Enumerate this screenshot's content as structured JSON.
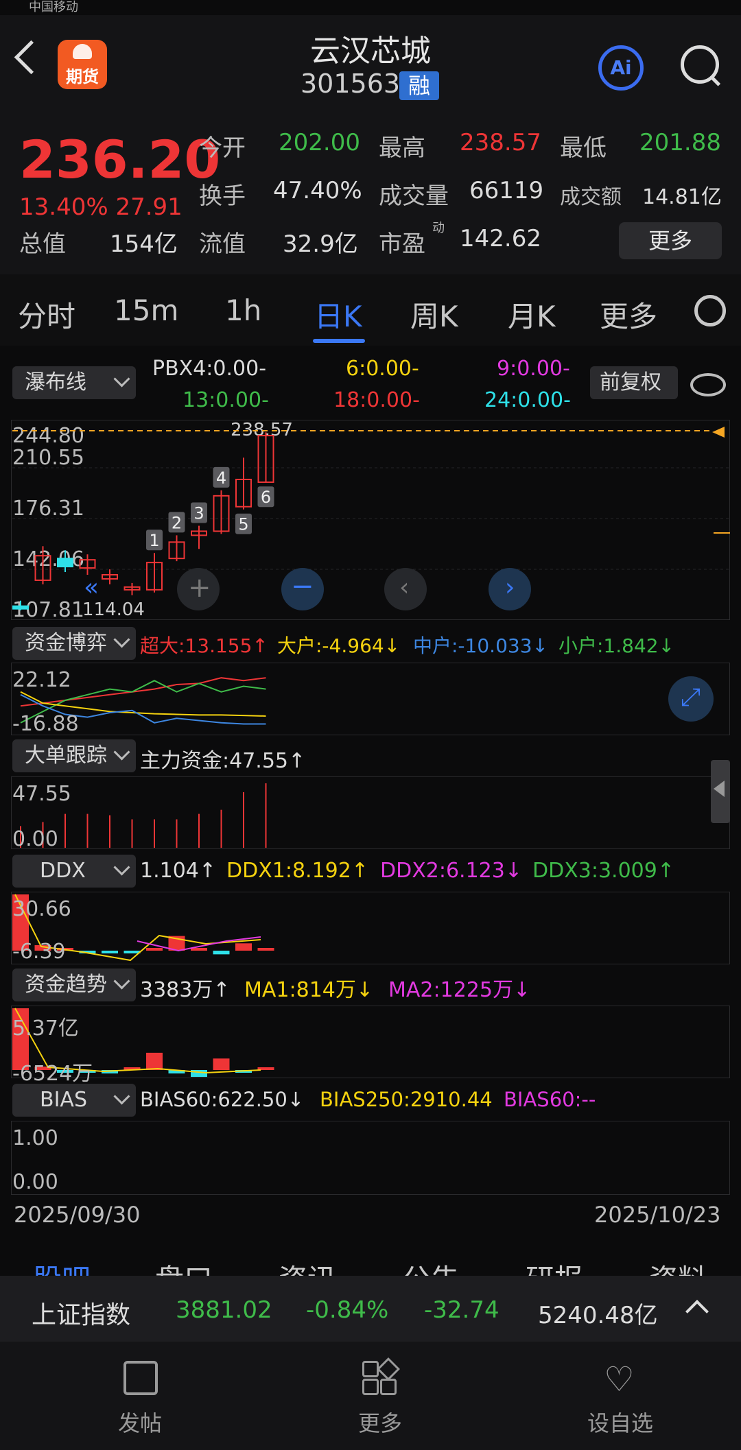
{
  "status": {
    "carrier": "中国移动"
  },
  "header": {
    "title": "云汉芯城",
    "code": "301563",
    "margin_badge": "融",
    "futures_label": "期货",
    "ai_label": "Ai"
  },
  "quote": {
    "price": "236.20",
    "change_pct": "13.40%",
    "change": "27.91",
    "open_label": "今开",
    "open": "202.00",
    "high_label": "最高",
    "high": "238.57",
    "low_label": "最低",
    "low": "201.88",
    "turnover_label": "换手",
    "turnover": "47.40%",
    "volume_label": "成交量",
    "volume": "66119",
    "amount_label": "成交额",
    "amount": "14.81亿",
    "mcap_label": "总值",
    "mcap": "154亿",
    "float_label": "流值",
    "float": "32.9亿",
    "pe_label": "市盈",
    "pe_sup": "动",
    "pe": "142.62",
    "more": "更多"
  },
  "tabs": [
    {
      "label": "分时"
    },
    {
      "label": "15m"
    },
    {
      "label": "1h"
    },
    {
      "label": "日K"
    },
    {
      "label": "周K"
    },
    {
      "label": "月K"
    },
    {
      "label": "更多"
    }
  ],
  "indicator_bar": {
    "select": "瀑布线",
    "pbx4": "PBX4:0.00-",
    "p6": "6:0.00-",
    "p9": "9:0.00-",
    "p13": "13:0.00-",
    "p18": "18:0.00-",
    "p24": "24:0.00-",
    "adjust": "前复权"
  },
  "kline": {
    "y_top": "244.80",
    "y2": "210.55",
    "y3": "176.31",
    "y4": "142.06",
    "y_bottom": "107.81",
    "max_label": "238.57",
    "min_label": "114.04",
    "badges": [
      "1",
      "2",
      "3",
      "4",
      "5",
      "6"
    ]
  },
  "capital_game": {
    "select": "资金博弈",
    "super": "超大:13.155↑",
    "large": "大户:-4.964↓",
    "mid": "中户:-10.033↓",
    "small": "小户:1.842↓",
    "y_top": "22.12",
    "y_bottom": "-16.88"
  },
  "big_order": {
    "select": "大单跟踪",
    "main": "主力资金:47.55↑",
    "y_top": "47.55",
    "y_bottom": "0.00"
  },
  "ddx": {
    "select": "DDX",
    "val": "1.104↑",
    "ddx1": "DDX1:8.192↑",
    "ddx2": "DDX2:6.123↓",
    "ddx3": "DDX3:3.009↑",
    "y_top": "30.66",
    "y_bottom": "-6.39"
  },
  "fund_trend": {
    "select": "资金趋势",
    "val": "3383万↑",
    "ma1": "MA1:814万↓",
    "ma2": "MA2:1225万↓",
    "y_top": "5.37亿",
    "y_bottom": "-6524万"
  },
  "bias": {
    "select": "BIAS",
    "b60": "BIAS60:622.50↓",
    "b250": "BIAS250:2910.44",
    "b60b": "BIAS60:--",
    "y_top": "1.00",
    "y_bottom": "0.00"
  },
  "dates": {
    "start": "2025/09/30",
    "end": "2025/10/23"
  },
  "subtabs": [
    "股吧",
    "盘口",
    "资讯",
    "公告",
    "研报",
    "资料"
  ],
  "ticker": {
    "name": "上证指数",
    "value": "3881.02",
    "pct": "-0.84%",
    "chg": "-32.74",
    "amount": "5240.48亿"
  },
  "nav": {
    "post": "发帖",
    "more": "更多",
    "watch": "设自选"
  },
  "colors": {
    "up": "#ee3536",
    "down": "#3fbb4a",
    "accent": "#3b78f5",
    "cyan": "#2ee0e8",
    "yellow": "#f5d20f",
    "magenta": "#e23ae0",
    "blue": "#3d86e0"
  },
  "chart_data": {
    "type": "candlestick",
    "candles": [
      {
        "o": 111,
        "h": 115,
        "l": 108,
        "c": 109
      },
      {
        "o": 130,
        "h": 155,
        "l": 127,
        "c": 148
      },
      {
        "o": 146,
        "h": 152,
        "l": 136,
        "c": 140
      },
      {
        "o": 139,
        "h": 149,
        "l": 134,
        "c": 145
      },
      {
        "o": 131,
        "h": 138,
        "l": 127,
        "c": 134
      },
      {
        "o": 123,
        "h": 128,
        "l": 119,
        "c": 125
      },
      {
        "o": 123,
        "h": 150,
        "l": 121,
        "c": 143
      },
      {
        "o": 146,
        "h": 163,
        "l": 144,
        "c": 158
      },
      {
        "o": 163,
        "h": 170,
        "l": 153,
        "c": 166
      },
      {
        "o": 166,
        "h": 196,
        "l": 164,
        "c": 192
      },
      {
        "o": 184,
        "h": 220,
        "l": 182,
        "c": 204
      },
      {
        "o": 202,
        "h": 238.57,
        "l": 201.88,
        "c": 236.2
      }
    ],
    "ylim": [
      107.81,
      244.8
    ],
    "big_order_values": [
      16,
      19,
      25,
      25,
      24,
      21,
      21,
      21,
      25,
      28,
      41,
      47.55
    ],
    "ddx_values": [
      30.66,
      3,
      0,
      -1,
      -1,
      -1,
      0,
      8,
      0,
      -2,
      4,
      1.1
    ],
    "fund_trend_values": [
      5.37,
      0.3,
      -0.1,
      -0.1,
      -0.3,
      0.1,
      1.5,
      -0.3,
      -0.6,
      1,
      -0.1,
      0.2
    ]
  }
}
